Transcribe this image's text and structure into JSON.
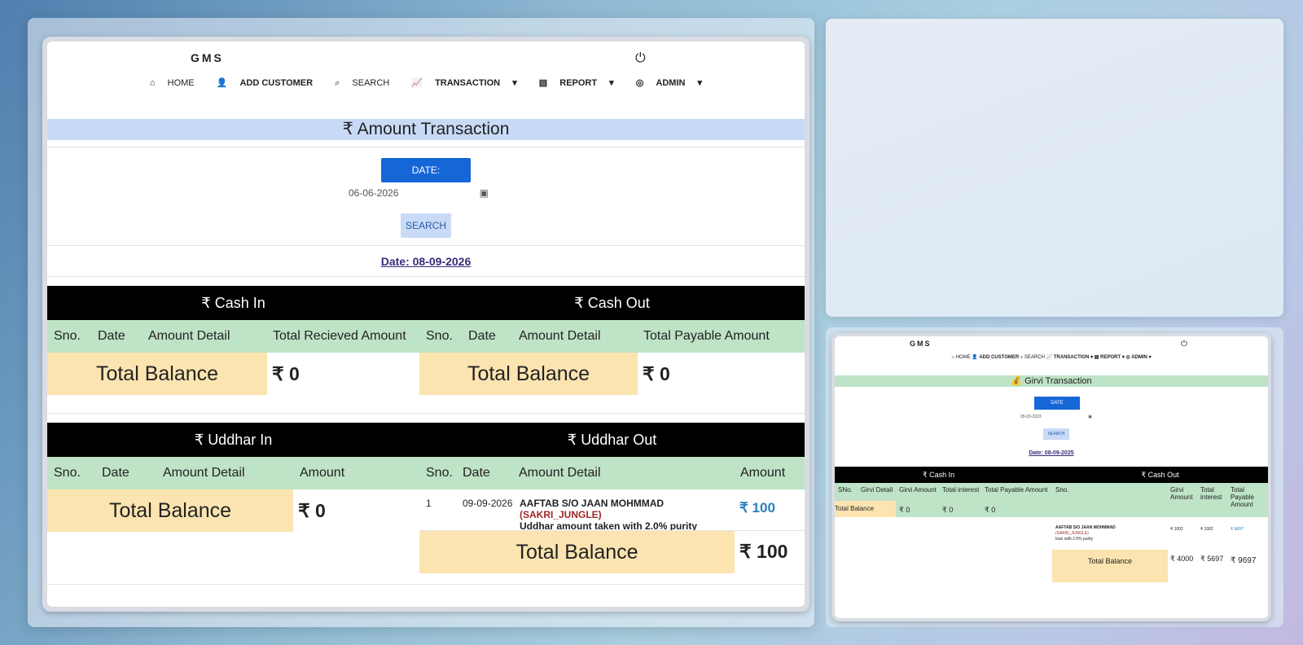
{
  "main": {
    "brand": "GMS",
    "nav": {
      "home": "HOME",
      "add_customer": "ADD CUSTOMER",
      "search": "SEARCH",
      "transaction": "TRANSACTION",
      "report": "REPORT",
      "admin": "ADMIN"
    },
    "page_title": "₹ Amount Transaction",
    "date_button": "DATE:",
    "date_value": "06-06-2026",
    "search_button": "SEARCH",
    "date_line": "Date: 08-09-2026",
    "cash_in_title": "₹ Cash In",
    "cash_out_title": "₹ Cash Out",
    "cash_in_cols": [
      "Sno.",
      "Date",
      "Amount Detail",
      "Total Recieved Amount"
    ],
    "cash_out_cols": [
      "Sno.",
      "Date",
      "Amount Detail",
      "Total Payable Amount"
    ],
    "total_balance_label": "Total Balance",
    "cash_in_total": "₹ 0",
    "cash_out_total": "₹ 0",
    "uddhar_in_title": "₹ Uddhar In",
    "uddhar_out_title": "₹ Uddhar Out",
    "uddhar_in_cols": [
      "Sno.",
      "Date",
      "Amount Detail",
      "Amount"
    ],
    "uddhar_out_cols": [
      "Sno.",
      "Date",
      "Amount Detail",
      "Amount"
    ],
    "uddhar_in_total": "₹ 0",
    "uddhar_out_entry": {
      "sno": "1",
      "date": "09-09-2026",
      "name": "AAFTAB S/O JAAN MOHMMAD",
      "tag": "(SAKRI_JUNGLE)",
      "detail": "Uddhar amount taken with 2.0% purity",
      "amount": "₹ 100"
    },
    "uddhar_out_total": "₹ 100"
  },
  "small": {
    "brand": "GMS",
    "nav": {
      "home": "HOME",
      "add_customer": "ADD CUSTOMER",
      "search": "SEARCH",
      "transaction": "TRANSACTION",
      "report": "REPORT",
      "admin": "ADMIN"
    },
    "page_title": "Girvi Transaction",
    "date_button": "DATE",
    "date_value": "05-03-2023",
    "search_button": "SEARCH",
    "date_line": "Date: 08-09-2025",
    "cash_in_title": "₹ Cash In",
    "cash_out_title": "₹ Cash Out",
    "cash_in_cols": [
      "SNo.",
      "Girvi Detail",
      "Girvi Amount",
      "Total interest",
      "Total Payable Amount"
    ],
    "cash_out_cols": [
      "Sno.",
      "Girvi Amount",
      "Total interest",
      "Total Payable Amount"
    ],
    "cash_in_totals": [
      "Total Balance",
      "₹ 0",
      "₹ 0",
      "₹ 0"
    ],
    "entry_name": "AAFTAB S/O JAAN MOHMMAD",
    "entry_tag": "(SAKRI_JUNGLE)",
    "entry_detail": "loan with 2.0% purity",
    "entry_vals": [
      "₹ 1002",
      "₹ 1002",
      "₹ 9697"
    ],
    "out_totals": [
      "Total Balance",
      "₹ 4000",
      "₹ 5697",
      "₹ 9697"
    ]
  }
}
